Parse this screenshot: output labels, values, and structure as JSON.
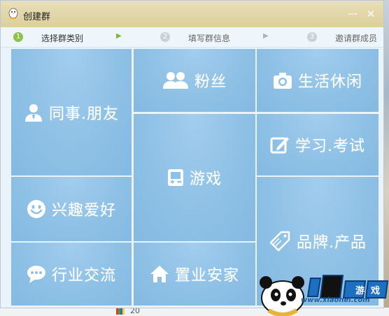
{
  "window": {
    "title": "创建群",
    "min_label": "—",
    "close_label": "✕"
  },
  "steps": [
    {
      "num": "1",
      "label": "选择群类别",
      "state": "active"
    },
    {
      "num": "2",
      "label": "填写群信息",
      "state": "inactive"
    },
    {
      "num": "3",
      "label": "邀请群成员",
      "state": "inactive"
    }
  ],
  "categories": {
    "colleagues": {
      "label": "同事.朋友",
      "icon": "person-tie-icon"
    },
    "fans": {
      "label": "粉丝",
      "icon": "group-people-icon"
    },
    "leisure": {
      "label": "生活休闲",
      "icon": "camera-icon"
    },
    "study": {
      "label": "学习.考试",
      "icon": "edit-note-icon"
    },
    "games": {
      "label": "游戏",
      "icon": "game-console-icon"
    },
    "hobbies": {
      "label": "兴趣爱好",
      "icon": "smiley-icon"
    },
    "brands": {
      "label": "品牌.产品",
      "icon": "price-tag-icon"
    },
    "industry": {
      "label": "行业交流",
      "icon": "chat-bubble-icon"
    },
    "realestate": {
      "label": "置业安家",
      "icon": "house-icon"
    }
  },
  "background": {
    "taskbar_number": "20"
  },
  "watermark": {
    "site": "www.xiaohei.com",
    "logo_text": "小黑游戏"
  },
  "colors": {
    "tile": "#8fc1e6",
    "titlebar": "#e2d6a8",
    "step_active": "#8dc24a"
  }
}
